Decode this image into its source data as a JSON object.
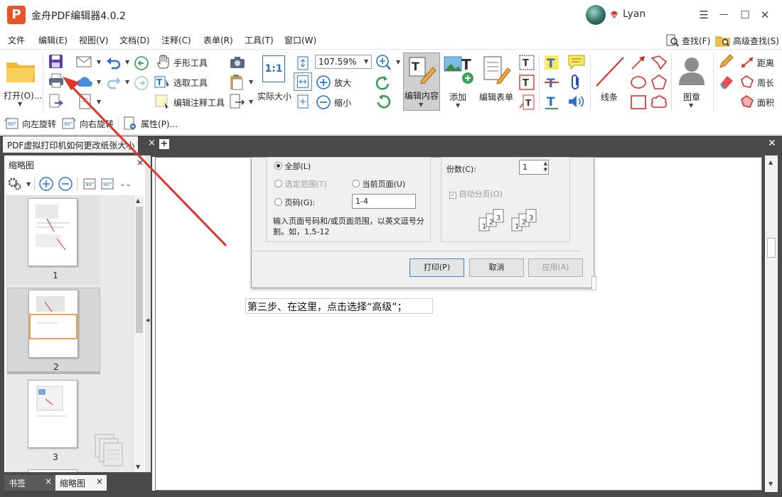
{
  "app": {
    "title": "金舟PDF编辑器4.0.2",
    "logo_letter": "P",
    "user": "Lyan"
  },
  "window_controls": {
    "menu": "☰",
    "minimize": "—",
    "maximize": "☐",
    "close": "✕"
  },
  "menu": [
    "文件",
    "编辑(E)",
    "视图(V)",
    "文档(D)",
    "注释(C)",
    "表单(R)",
    "工具(T)",
    "窗口(W)"
  ],
  "search": {
    "find": "查找(F)",
    "advanced_find": "高级查找(S)"
  },
  "toolbar": {
    "open": "打开(O)...",
    "hand_tool": "手形工具",
    "select_tool": "选取工具",
    "edit_annotation_tool": "编辑注释工具",
    "actual_size": "实际大小",
    "zoom_value": "107.59%",
    "zoom_in": "放大",
    "zoom_out": "缩小",
    "edit_content": "编辑内容",
    "add": "添加",
    "edit_form": "编辑表单",
    "line": "线条",
    "stamp": "图章",
    "distance": "距离",
    "perimeter": "周长",
    "area": "面积",
    "rotate_left": "向左旋转",
    "rotate_right": "向右旋转",
    "properties": "属性(P)...",
    "actual_size_icon": "1:1"
  },
  "tabs": {
    "doc_tab": "PDF虚拟打印机如何更改纸张大小 *",
    "close": "×",
    "add": "+",
    "close_all": "✕"
  },
  "panel": {
    "title": "缩略图",
    "close": "×",
    "pages": [
      "1",
      "2",
      "3"
    ],
    "bottom_tabs": [
      {
        "label": "书签",
        "close": "×"
      },
      {
        "label": "缩略图",
        "close": "×"
      }
    ]
  },
  "dialog": {
    "all": "全部(L)",
    "selection": "选定范围(T)",
    "current_page": "当前页面(U)",
    "pages": "页码(G):",
    "pages_value": "1-4",
    "hint_line1": "输入页面号码和/或页面范围，以英文逗号分",
    "hint_line2": "割。如，1,5-12",
    "copies_label": "份数(C):",
    "copies_value": "1",
    "collate": "自动分页(O)",
    "print_btn": "打印(P)",
    "cancel_btn": "取消",
    "apply_btn": "应用(A)"
  },
  "caption": "第三步、在这里，点击选择“高级”；",
  "colors": {
    "accent": "#e8532a",
    "arrow": "#e0332c",
    "frame": "#4a4a4a"
  }
}
